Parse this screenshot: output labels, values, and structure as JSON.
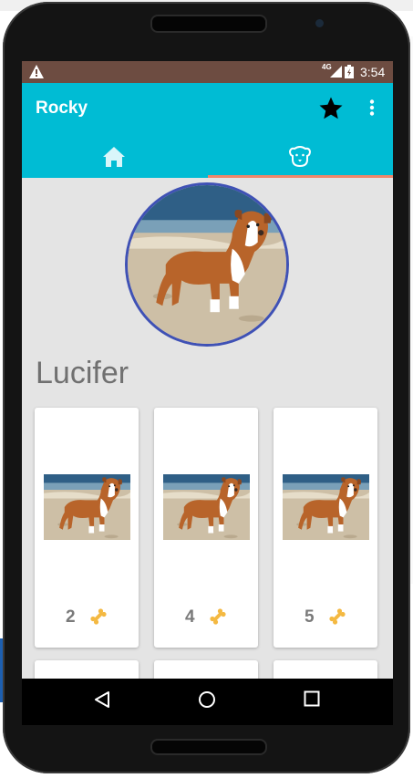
{
  "app": {
    "title": "Rocky",
    "toolbar_icons": [
      "star-icon",
      "more-vert-icon"
    ]
  },
  "status_bar": {
    "network": "4G",
    "time": "3:54"
  },
  "tabs": [
    {
      "icon": "home-icon",
      "selected": false
    },
    {
      "icon": "dog-icon",
      "selected": true
    }
  ],
  "profile": {
    "name": "Lucifer"
  },
  "cards": [
    {
      "count": "2",
      "icon": "bone-icon"
    },
    {
      "count": "4",
      "icon": "bone-icon"
    },
    {
      "count": "5",
      "icon": "bone-icon"
    }
  ],
  "colors": {
    "status_bar": "#6d4c41",
    "app_bar": "#00bcd4",
    "tab_indicator": "#f2876a",
    "avatar_border": "#3f51b5",
    "bone": "#f4b942"
  }
}
